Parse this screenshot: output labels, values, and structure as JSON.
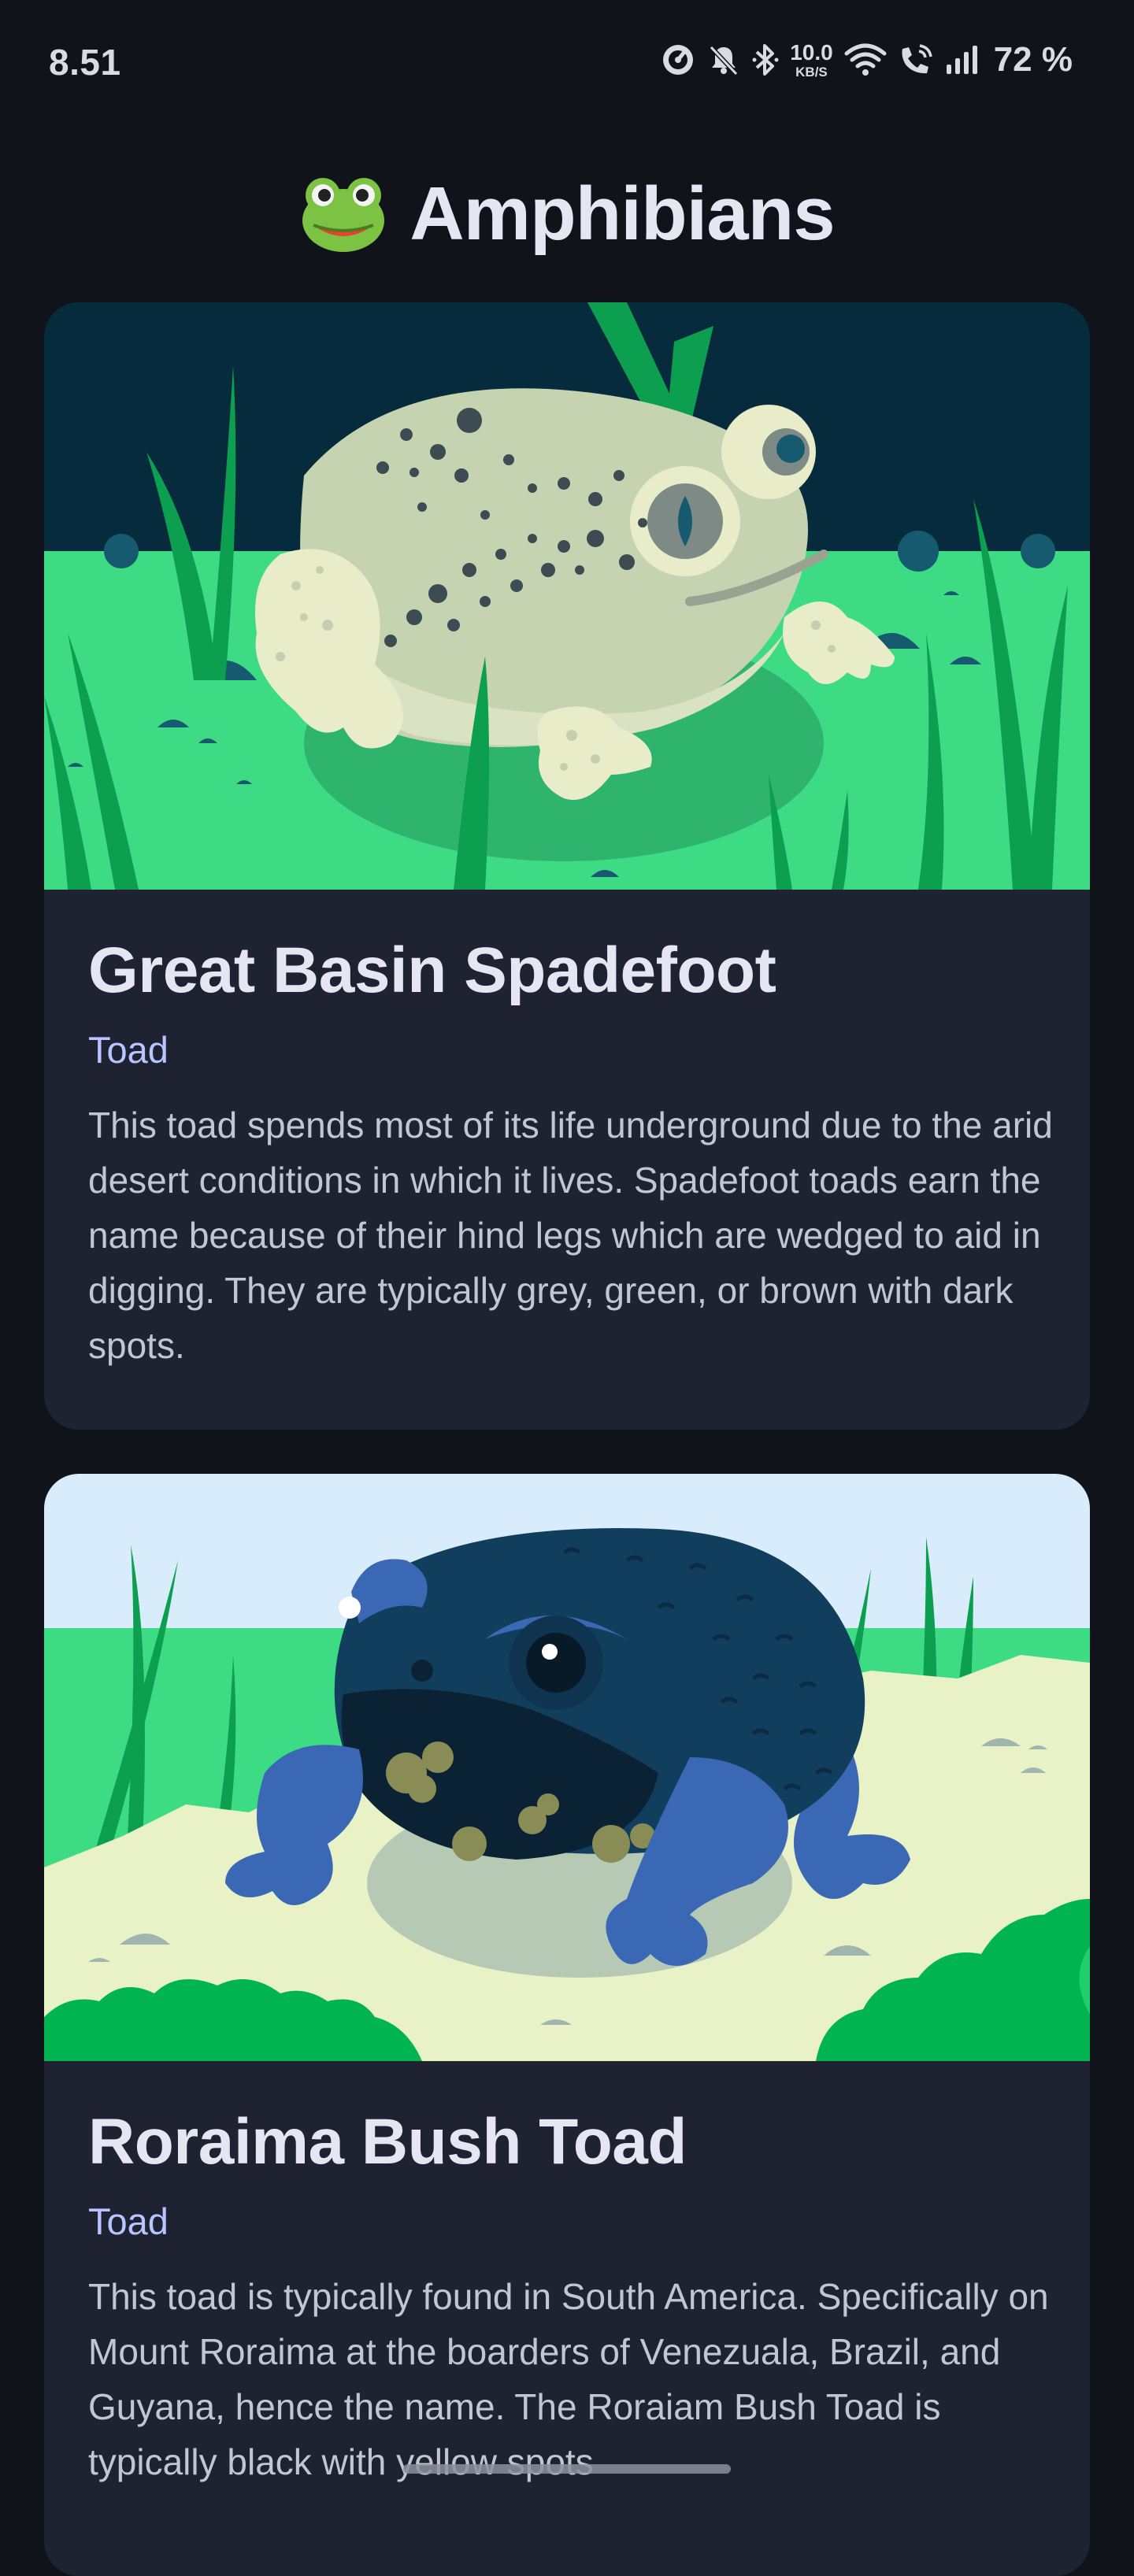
{
  "status_bar": {
    "time": "8.51",
    "net_speed_value": "10.0",
    "net_speed_unit": "KB/S",
    "battery": "72 %",
    "icons": [
      "speedometer-icon",
      "bell-off-icon",
      "bluetooth-icon",
      "wifi-icon",
      "wifi-call-icon",
      "signal-icon"
    ]
  },
  "header": {
    "emoji": "frog-face",
    "title": "Amphibians"
  },
  "cards": [
    {
      "name": "Great Basin Spadefoot",
      "type": "Toad",
      "description": "This toad spends most of its life underground due to the arid desert conditions in which it lives. Spadefoot toads earn the name because of their hind legs which are wedged to aid in digging. They are typically grey, green, or brown with dark spots.",
      "image": "spadefoot-toad-illustration"
    },
    {
      "name": "Roraima Bush Toad",
      "type": "Toad",
      "description": "This toad is typically found in South America. Specifically on Mount Roraima at the boarders of Venezuala, Brazil, and Guyana, hence the name. The Roraiam Bush Toad is typically black with yellow spots",
      "image": "bush-toad-illustration"
    }
  ],
  "colors": {
    "background": "#11131a",
    "card": "#1f2230",
    "accent": "#b8c4ff",
    "grass": "#3ddc84"
  }
}
